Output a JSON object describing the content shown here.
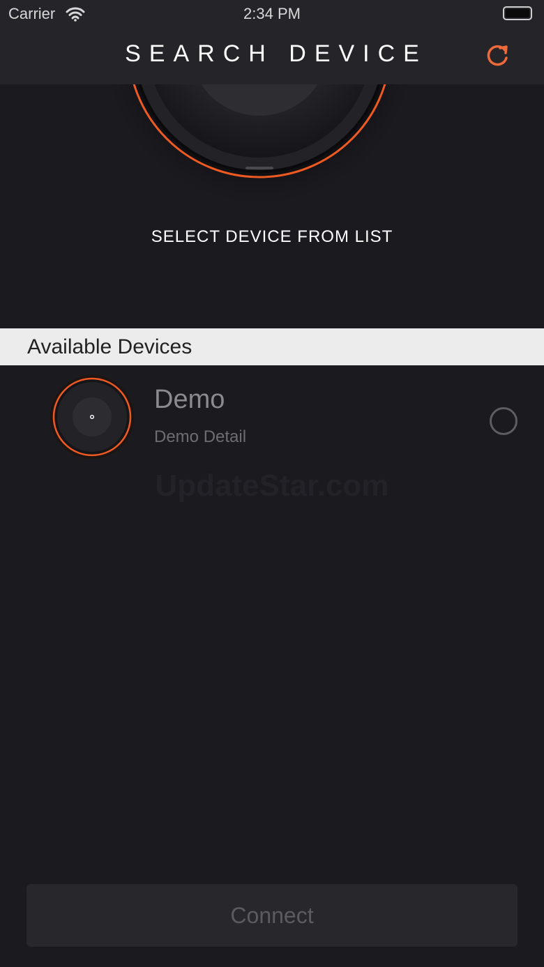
{
  "status_bar": {
    "carrier": "Carrier",
    "time": "2:34 PM",
    "icons": [
      "wifi-icon",
      "battery-icon"
    ]
  },
  "nav": {
    "title": "SEARCH DEVICE",
    "refresh_icon": "refresh-icon"
  },
  "hero": {
    "caption": "SELECT DEVICE FROM LIST"
  },
  "devices": {
    "section_title": "Available Devices",
    "items": [
      {
        "name": "Demo",
        "detail": "Demo Detail",
        "selected": false
      }
    ]
  },
  "watermark": "UpdateStar.com",
  "connect_label": "Connect",
  "colors": {
    "background": "#1b1a1f",
    "bar": "#252428",
    "accent": "#ef6a3a",
    "section_header": "#ececec"
  }
}
